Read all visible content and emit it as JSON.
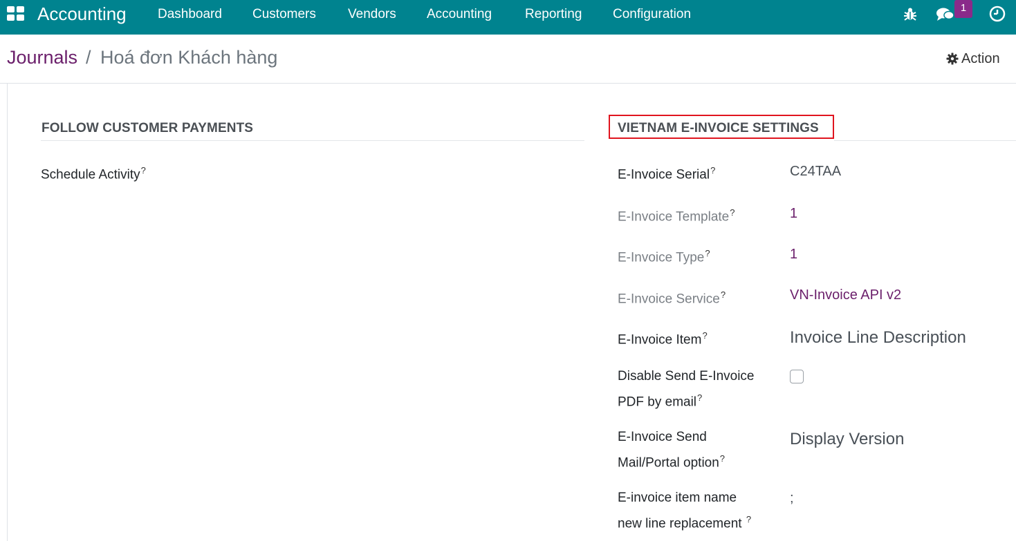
{
  "navbar": {
    "app_title": "Accounting",
    "menu": [
      "Dashboard",
      "Customers",
      "Vendors",
      "Accounting",
      "Reporting",
      "Configuration"
    ],
    "messages_badge": "1",
    "icons": [
      "apps-grid-icon",
      "bug-icon",
      "chat-icon",
      "clock-icon"
    ],
    "background_color": "#00838f"
  },
  "breadcrumb": {
    "parent": "Journals",
    "separator": "/",
    "current": "Hoá đơn Khách hàng"
  },
  "action_label": "Action",
  "left_section": {
    "title": "FOLLOW CUSTOMER PAYMENTS",
    "schedule_activity_label": "Schedule Activity"
  },
  "vn_section": {
    "title": "VIETNAM E-INVOICE SETTINGS",
    "fields": {
      "serial": {
        "label": "E-Invoice Serial",
        "value": "C24TAA"
      },
      "template": {
        "label": "E-Invoice Template",
        "value": "1"
      },
      "type": {
        "label": "E-Invoice Type",
        "value": "1"
      },
      "service": {
        "label": "E-Invoice Service",
        "value": "VN-Invoice API v2"
      },
      "item": {
        "label": "E-Invoice Item",
        "value": "Invoice Line Description"
      },
      "disable_send": {
        "label_line1": "Disable Send E-Invoice",
        "label_line2": "PDF by email",
        "checked": false
      },
      "send_option": {
        "label_line1": "E-Invoice Send",
        "label_line2": "Mail/Portal option",
        "value": "Display Version"
      },
      "newline_replacement": {
        "label_line1": "E-invoice item name",
        "label_line2": "new line replacement ",
        "value": ";"
      }
    },
    "help_mark": "?",
    "highlight_color": "#e0141e"
  }
}
